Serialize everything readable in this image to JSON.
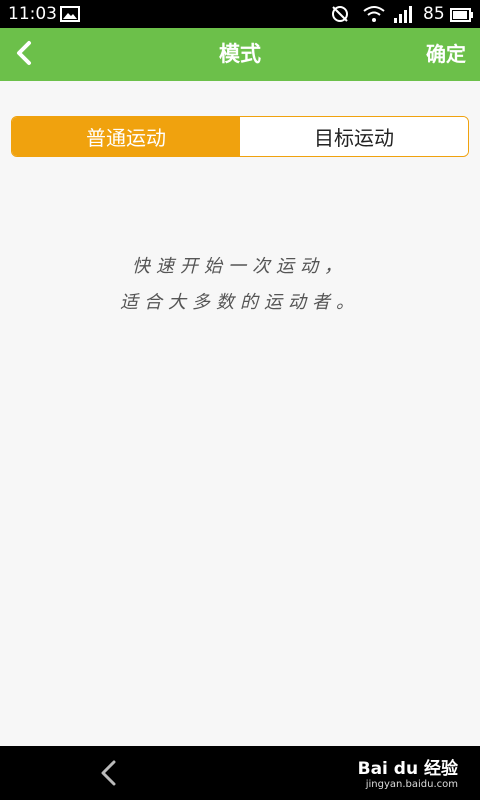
{
  "status_bar": {
    "time": "11:03",
    "battery_level": "85",
    "icons": [
      "image-icon",
      "mute-icon",
      "wifi-icon",
      "signal-icon",
      "battery-icon"
    ]
  },
  "header": {
    "back_icon": "chevron-left-icon",
    "title": "模式",
    "confirm_label": "确定",
    "background_color": "#6cc04a"
  },
  "tabs": [
    {
      "label": "普通运动",
      "selected": true
    },
    {
      "label": "目标运动",
      "selected": false
    }
  ],
  "accent_color": "#f0a20e",
  "description": {
    "line1": "快速开始一次运动，",
    "line2": "适合大多数的运动者。"
  },
  "nav_bar": {
    "back_icon": "chevron-left-icon",
    "watermark_main": "Bai du 经验",
    "watermark_sub": "jingyan.baidu.com"
  }
}
